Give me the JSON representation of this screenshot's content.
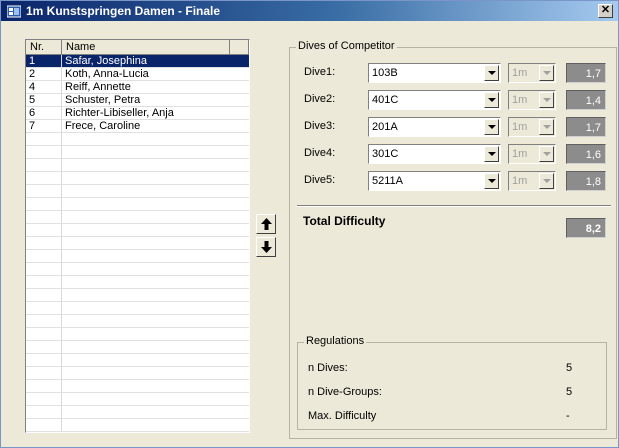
{
  "window": {
    "title": "1m Kunstspringen Damen - Finale",
    "close_label": "✕"
  },
  "competitors": {
    "headers": {
      "nr": "Nr.",
      "name": "Name"
    },
    "rows": [
      {
        "nr": "1",
        "name": "Safar, Josephina",
        "selected": true
      },
      {
        "nr": "2",
        "name": "Koth, Anna-Lucia"
      },
      {
        "nr": "4",
        "name": "Reiff, Annette"
      },
      {
        "nr": "5",
        "name": "Schuster, Petra"
      },
      {
        "nr": "6",
        "name": "Richter-Libiseller, Anja"
      },
      {
        "nr": "7",
        "name": "Frece, Caroline"
      }
    ],
    "empty_rows": 23
  },
  "move": {
    "up_icon": "arrow-up-icon",
    "down_icon": "arrow-down-icon"
  },
  "dives_group": {
    "title": "Dives of Competitor",
    "dives": [
      {
        "label": "Dive1:",
        "code": "103B",
        "height": "1m",
        "difficulty": "1,7"
      },
      {
        "label": "Dive2:",
        "code": "401C",
        "height": "1m",
        "difficulty": "1,4"
      },
      {
        "label": "Dive3:",
        "code": "201A",
        "height": "1m",
        "difficulty": "1,7"
      },
      {
        "label": "Dive4:",
        "code": "301C",
        "height": "1m",
        "difficulty": "1,6"
      },
      {
        "label": "Dive5:",
        "code": "5211A",
        "height": "1m",
        "difficulty": "1,8"
      }
    ],
    "total_label": "Total Difficulty",
    "total_value": "8,2"
  },
  "regulations": {
    "title": "Regulations",
    "items": [
      {
        "label": "n Dives:",
        "value": "5"
      },
      {
        "label": "n Dive-Groups:",
        "value": "5"
      },
      {
        "label": "Max. Difficulty",
        "value": "-"
      }
    ]
  },
  "colors": {
    "selection": "#0a246a",
    "window_bg": "#ece9d8",
    "difficulty_bg": "#8c8c8c"
  }
}
